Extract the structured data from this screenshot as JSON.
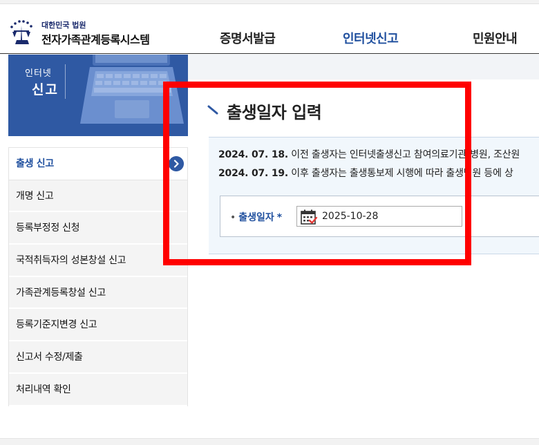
{
  "header": {
    "logo_small": "대한민국 법원",
    "logo_big": "전자가족관계등록시스템",
    "nav": [
      {
        "label": "증명서발급",
        "active": false
      },
      {
        "label": "인터넷신고",
        "active": true
      },
      {
        "label": "민원안내",
        "active": false
      }
    ]
  },
  "banner": {
    "line1": "인터넷",
    "line2": "신고"
  },
  "sidebar": {
    "items": [
      {
        "label": "출생 신고",
        "active": true
      },
      {
        "label": "개명 신고"
      },
      {
        "label": "등록부정정 신청"
      },
      {
        "label": "국적취득자의 성본창설 신고"
      },
      {
        "label": "가족관계등록창설 신고"
      },
      {
        "label": "등록기준지변경 신고"
      },
      {
        "label": "신고서 수정/제출"
      },
      {
        "label": "처리내역 확인"
      }
    ]
  },
  "main": {
    "title": "출생일자 입력",
    "notice": [
      {
        "date": "2024. 07. 18.",
        "text": " 이전 출생자는 인터넷출생신고 참여의료기관(병원, 조산원"
      },
      {
        "date": "2024. 07. 19.",
        "text": " 이후 출생자는 출생통보제 시행에 따라 출생병원 등에 상"
      }
    ],
    "form": {
      "label": "출생일자",
      "required_mark": "*",
      "bullet": "•",
      "date_value": "2025-10-28"
    }
  },
  "colors": {
    "accent": "#1f4f9e",
    "banner": "#2f59a3",
    "highlight": "#ff0000"
  }
}
